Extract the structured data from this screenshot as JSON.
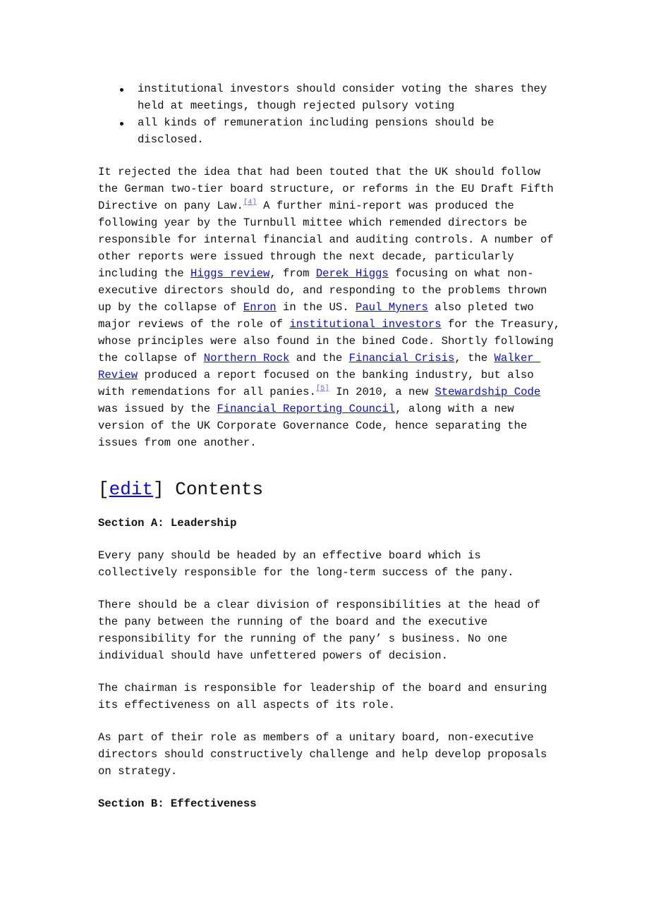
{
  "bullets": [
    "institutional investors should consider voting the shares they held at meetings, though rejected pulsory voting",
    "all kinds of remuneration including pensions should be disclosed."
  ],
  "history": {
    "t1": "It rejected the idea that had been touted that the UK should follow the German two-tier board structure, or reforms in the EU Draft Fifth Directive on pany Law.",
    "ref4": "[4]",
    "t2": " A further mini-report was produced the following year by the Turnbull mittee which remended directors be responsible for internal financial and auditing controls. A number of other reports were issued through the next decade, particularly including the ",
    "link_higgs_review": "Higgs review",
    "t3": ", from ",
    "link_derek_higgs": "Derek Higgs",
    "t4": " focusing on what non-executive directors should do, and responding to the problems thrown up by the collapse of ",
    "link_enron": "Enron",
    "t5": " in the US. ",
    "link_paul_myners": "Paul Myners",
    "t6": " also pleted two major reviews of the role of ",
    "link_institutional_investors": "institutional investors",
    "t7": " for the Treasury, whose principles were also found in the bined Code. Shortly following the collapse of ",
    "link_northern_rock": "Northern Rock",
    "t8": " and the ",
    "link_financial_crisis": "Financial Crisis",
    "t9": ", the ",
    "link_walker_review": "Walker Review",
    "t10": " produced a report focused on the banking industry, but also with remendations for all panies.",
    "ref5": "[5]",
    "t11": " In 2010, a new ",
    "link_stewardship_code": "Stewardship Code",
    "t12": " was issued by the ",
    "link_frc": "Financial Reporting Council",
    "t13": ", along with a new version of the UK Corporate Governance Code, hence separating the issues from one another."
  },
  "contents_heading": {
    "bracket_open": "[",
    "edit_label": "edit",
    "bracket_close": "]",
    "title": " Contents"
  },
  "section_a": {
    "title": "Section A: Leadership",
    "paragraphs": [
      "Every pany should be headed by an effective board which is collectively responsible for the long-term success of the pany.",
      "There should be a clear division of responsibilities at the head of the pany between the running of the board and the executive responsibility for the running of the pany’ s business. No one individual should have unfettered powers of decision.",
      "The chairman is responsible for leadership of the board and ensuring its effectiveness on all aspects of its role.",
      "As part of their role as members of a unitary board, non-executive directors should constructively challenge and help develop proposals on strategy."
    ]
  },
  "section_b": {
    "title": "Section B: Effectiveness"
  }
}
